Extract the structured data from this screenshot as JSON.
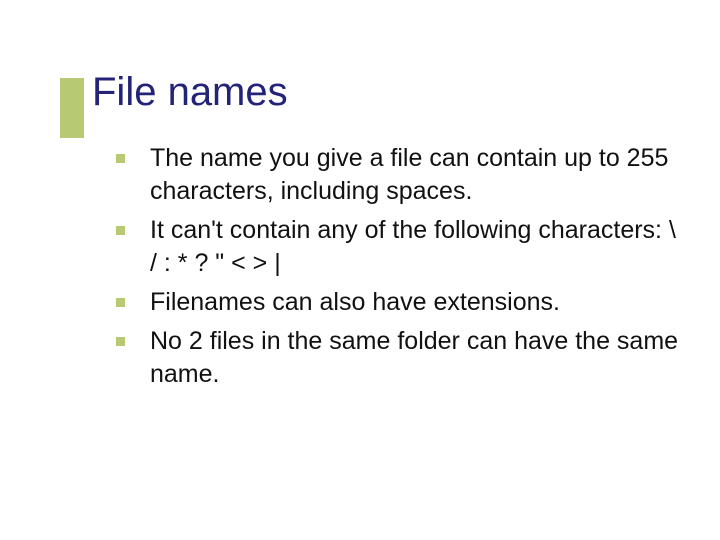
{
  "slide": {
    "title": "File names",
    "bullets": [
      "The name you give a file can contain up to 255 characters, including spaces.",
      "It can't contain any of the following characters: \\ / : * ? \" < > |",
      "Filenames can also have extensions.",
      "No 2 files in the same folder can have the same name."
    ]
  }
}
